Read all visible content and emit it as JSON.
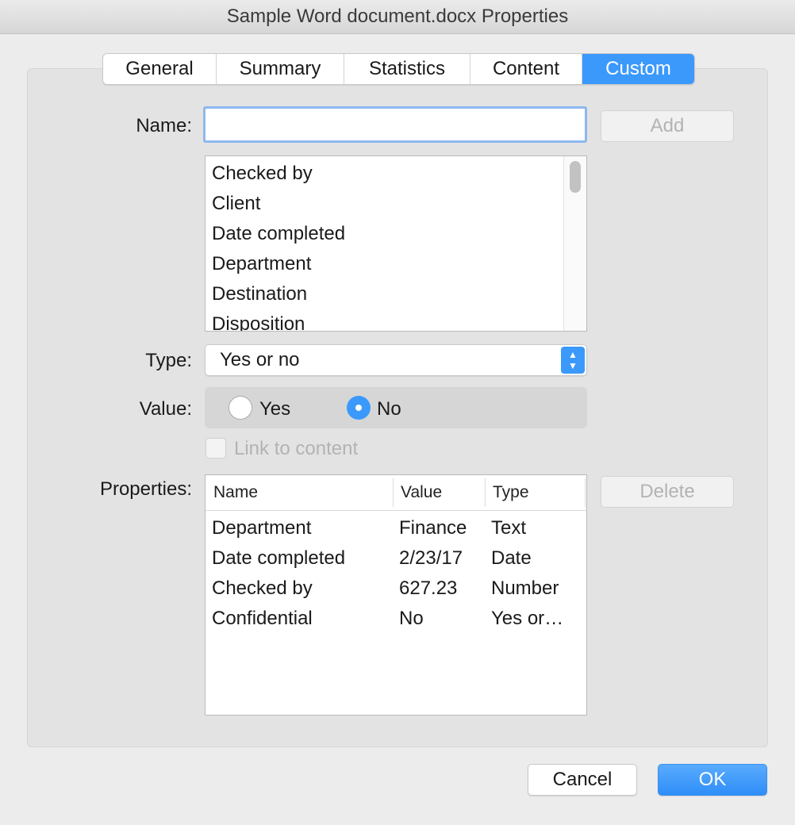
{
  "window": {
    "title": "Sample Word document.docx Properties"
  },
  "tabs": [
    {
      "label": "General"
    },
    {
      "label": "Summary"
    },
    {
      "label": "Statistics"
    },
    {
      "label": "Content"
    },
    {
      "label": "Custom",
      "active": true
    }
  ],
  "form": {
    "name_label": "Name:",
    "name_value": "",
    "add_label": "Add",
    "type_label": "Type:",
    "type_value": "Yes or no",
    "value_label": "Value:",
    "radio_yes": "Yes",
    "radio_no": "No",
    "selected_value": "No",
    "link_label": "Link to content",
    "properties_label": "Properties:",
    "delete_label": "Delete"
  },
  "name_list": [
    "Checked by",
    "Client",
    "Date completed",
    "Department",
    "Destination",
    "Disposition"
  ],
  "properties_table": {
    "headers": [
      "Name",
      "Value",
      "Type"
    ],
    "rows": [
      [
        "Department",
        "Finance",
        "Text"
      ],
      [
        "Date completed",
        "2/23/17",
        "Date"
      ],
      [
        "Checked by",
        "627.23",
        "Number"
      ],
      [
        "Confidential",
        "No",
        "Yes or…"
      ]
    ]
  },
  "footer": {
    "cancel_label": "Cancel",
    "ok_label": "OK"
  },
  "colors": {
    "accent": "#3b99fc"
  }
}
